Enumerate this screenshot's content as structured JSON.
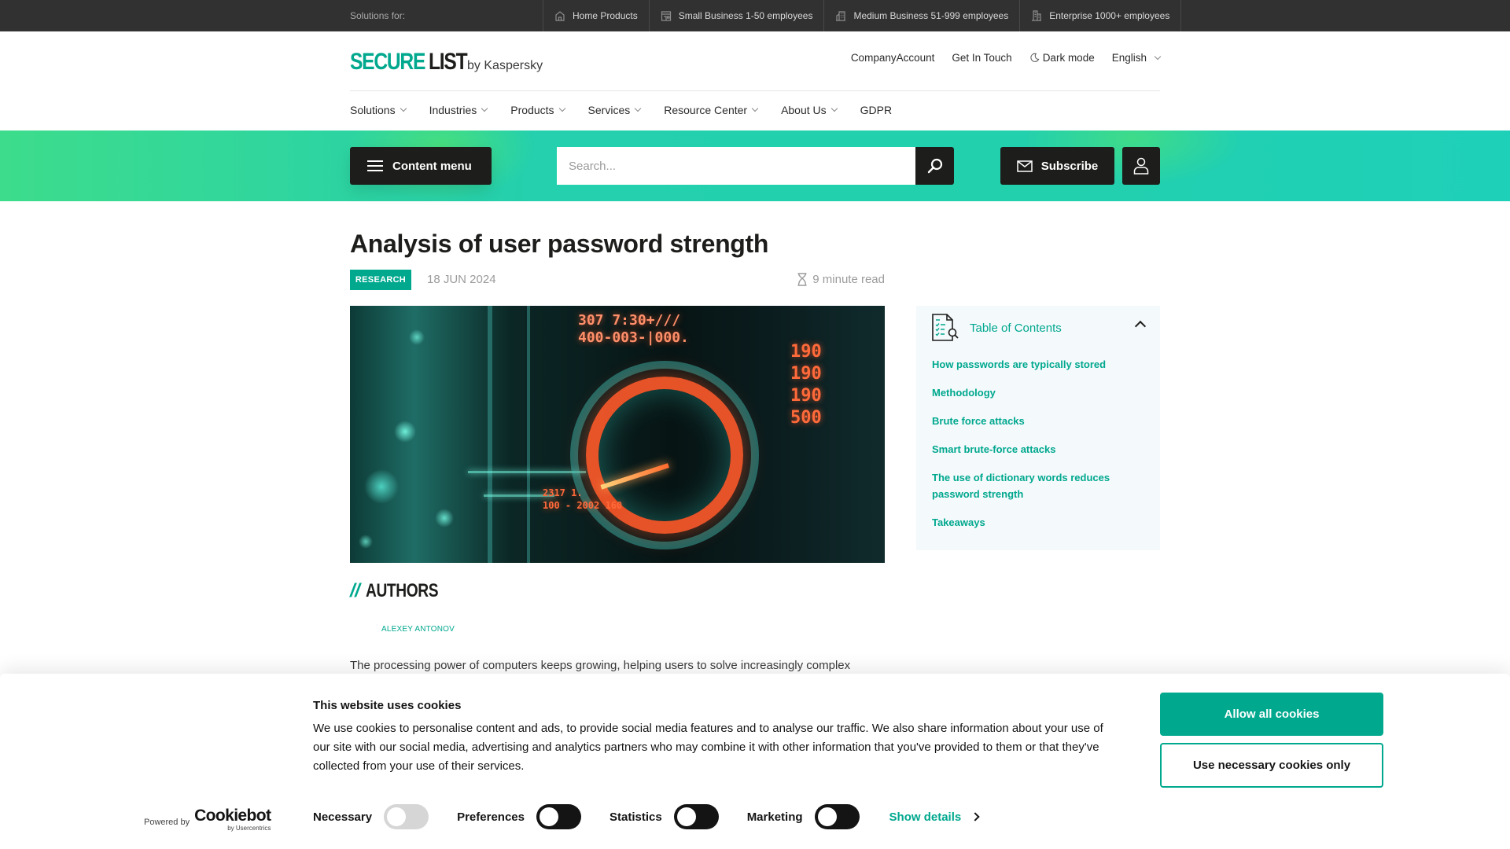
{
  "topbar": {
    "label": "Solutions for:",
    "segments": [
      {
        "icon": "home-icon",
        "label": "Home Products"
      },
      {
        "icon": "shop-icon",
        "label": "Small Business 1-50 employees"
      },
      {
        "icon": "building-icon",
        "label": "Medium Business 51-999 employees"
      },
      {
        "icon": "skyscraper-icon",
        "label": "Enterprise 1000+ employees"
      }
    ]
  },
  "header": {
    "logo": {
      "part1": "SECURE",
      "part2": "LIST",
      "suffix": "by Kaspersky"
    },
    "links": {
      "company_account": "CompanyAccount",
      "get_in_touch": "Get In Touch",
      "dark_mode": "Dark mode",
      "language": "English"
    },
    "nav": [
      "Solutions",
      "Industries",
      "Products",
      "Services",
      "Resource Center",
      "About Us",
      "GDPR"
    ]
  },
  "band": {
    "content_menu_label": "Content menu",
    "search_placeholder": "Search...",
    "subscribe_label": "Subscribe"
  },
  "article": {
    "title": "Analysis of user password strength",
    "category": "RESEARCH",
    "date": "18 JUN 2024",
    "read_time": "9 minute read",
    "hero": {
      "digits_top": "307 7:30+/// \n400-003-|000.",
      "digits_right": "190\n190\n190\n500",
      "digits_bottom": "2317 1.\n100 - 2002 160"
    },
    "authors_heading": "AUTHORS",
    "authors_slash": "//",
    "authors": [
      "ALEXEY ANTONOV"
    ],
    "intro": "The processing power of computers keeps growing, helping users to solve increasingly complex"
  },
  "toc": {
    "title": "Table of Contents",
    "items": [
      "How passwords are typically stored",
      "Methodology",
      "Brute force attacks",
      "Smart brute-force attacks",
      "The use of dictionary words reduces password strength",
      "Takeaways"
    ]
  },
  "cookie": {
    "title": "This website uses cookies",
    "body": "We use cookies to personalise content and ads, to provide social media features and to analyse our traffic. We also share information about your use of our site with our social media, advertising and analytics partners who may combine it with other information that you've provided to them or that they've collected from your use of their services.",
    "allow_all": "Allow all cookies",
    "necessary_only": "Use necessary cookies only",
    "powered_by": "Powered by",
    "brand": "Cookiebot",
    "brand_sub": "by Usercentrics",
    "consents": [
      {
        "label": "Necessary",
        "state": "on-disabled"
      },
      {
        "label": "Preferences",
        "state": "off"
      },
      {
        "label": "Statistics",
        "state": "off"
      },
      {
        "label": "Marketing",
        "state": "off"
      }
    ],
    "show_details": "Show details"
  },
  "colors": {
    "accent": "#00a88e",
    "dark": "#1d1d1b",
    "topbar": "#313131",
    "band": "#22d0ae",
    "toc_bg": "#f4f9fc"
  }
}
